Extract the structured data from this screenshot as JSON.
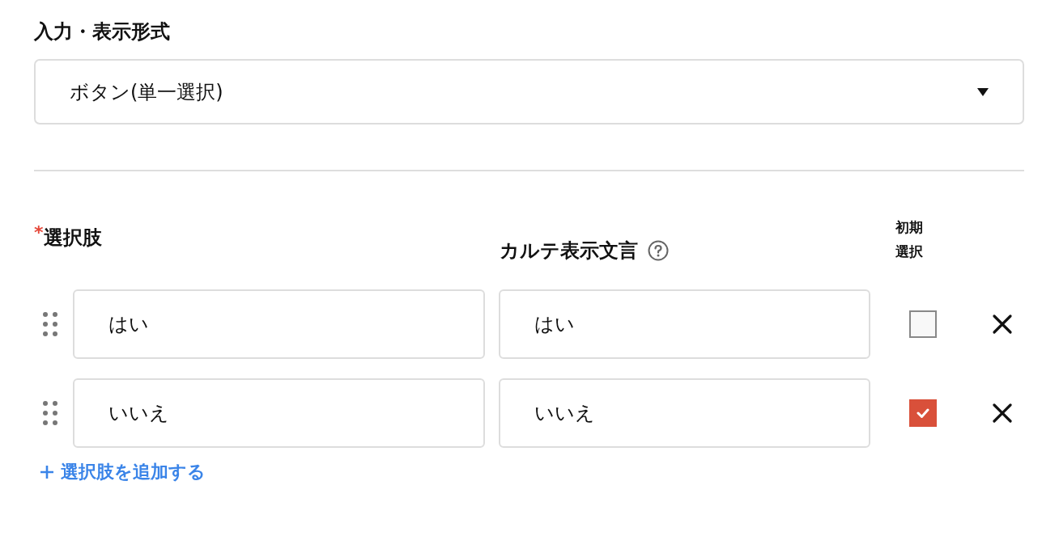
{
  "display_format": {
    "label": "入力・表示形式",
    "select": {
      "value": "ボタン(単一選択)"
    }
  },
  "choices": {
    "required": true,
    "required_mark": "*",
    "label": "選択肢",
    "chart_text_label": "カルテ表示文言",
    "default_label": "初期選択",
    "rows": [
      {
        "choice": "はい",
        "chart_text": "はい",
        "default_selected": false
      },
      {
        "choice": "いいえ",
        "chart_text": "いいえ",
        "default_selected": true
      }
    ],
    "add_label": "選択肢を追加する"
  }
}
